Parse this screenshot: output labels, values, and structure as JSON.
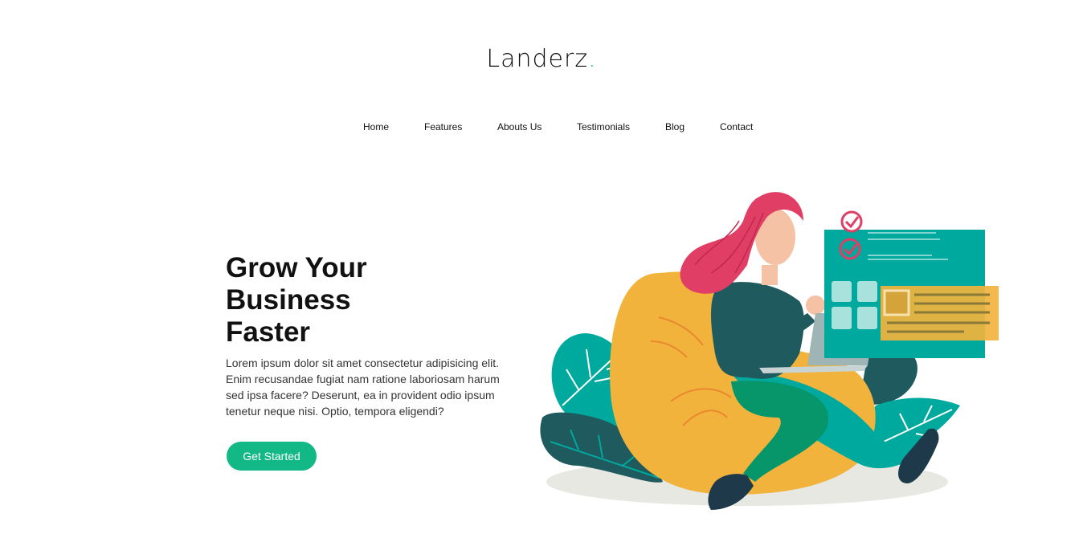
{
  "brand": {
    "name": "Landerz",
    "dot": "."
  },
  "nav": {
    "items": [
      "Home",
      "Features",
      "Abouts Us",
      "Testimonials",
      "Blog",
      "Contact"
    ]
  },
  "hero": {
    "title_line1": "Grow Your",
    "title_line2": "Business",
    "title_line3": "Faster",
    "description": "Lorem ipsum dolor sit amet consectetur adipisicing elit. Enim recusandae fugiat nam ratione laboriosam harum sed ipsa facere? Deserunt, ea in provident odio ipsum tenetur neque nisi. Optio, tempora eligendi?",
    "cta_label": "Get Started"
  },
  "colors": {
    "accent": "#12b886",
    "teal": "#00a99d",
    "pink": "#e03e64",
    "yellow": "#f2b33d",
    "dark_teal": "#1e5a5e"
  },
  "illustration": {
    "name": "woman-on-beanbag-illustration"
  }
}
